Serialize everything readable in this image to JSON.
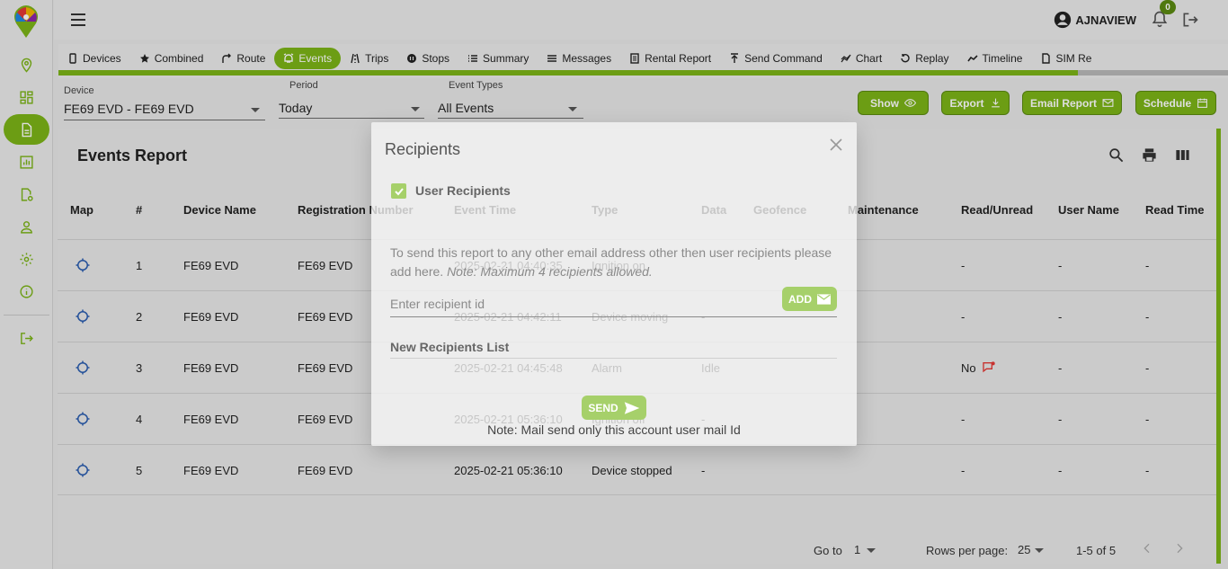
{
  "header": {
    "username": "AJNAVIEW",
    "notification_count": "0"
  },
  "sidebar": {
    "items": [
      {
        "icon": "map-pin-icon",
        "active": false
      },
      {
        "icon": "dashboard-icon",
        "active": false
      },
      {
        "icon": "report-icon",
        "active": true
      },
      {
        "icon": "chart-icon",
        "active": false
      },
      {
        "icon": "document-settings-icon",
        "active": false
      },
      {
        "icon": "user-icon",
        "active": false
      },
      {
        "icon": "gear-icon",
        "active": false
      },
      {
        "icon": "info-icon",
        "active": false
      },
      {
        "icon": "logout-icon",
        "active": false
      }
    ]
  },
  "tabs": [
    {
      "label": "Devices",
      "icon": "phone-icon"
    },
    {
      "label": "Combined",
      "icon": "star-icon"
    },
    {
      "label": "Route",
      "icon": "route-icon"
    },
    {
      "label": "Events",
      "icon": "alarm-icon",
      "active": true
    },
    {
      "label": "Trips",
      "icon": "trips-icon"
    },
    {
      "label": "Stops",
      "icon": "stop-icon"
    },
    {
      "label": "Summary",
      "icon": "list-icon"
    },
    {
      "label": "Messages",
      "icon": "messages-icon"
    },
    {
      "label": "Rental Report",
      "icon": "rental-icon"
    },
    {
      "label": "Send Command",
      "icon": "upload-icon"
    },
    {
      "label": "Chart",
      "icon": "chart-line-icon"
    },
    {
      "label": "Replay",
      "icon": "replay-icon"
    },
    {
      "label": "Timeline",
      "icon": "timeline-icon"
    },
    {
      "label": "SIM Re",
      "icon": "sim-icon"
    }
  ],
  "filters": {
    "device_label": "Device",
    "device_value": "FE69 EVD - FE69 EVD",
    "period_label": "Period",
    "period_value": "Today",
    "event_types_label": "Event Types",
    "event_types_value": "All Events"
  },
  "actions": {
    "show": "Show",
    "export": "Export",
    "email_report": "Email Report",
    "schedule": "Schedule"
  },
  "report": {
    "title": "Events Report",
    "columns": [
      "Map",
      "#",
      "Device Name",
      "Registration Number",
      "Event Time",
      "Type",
      "Data",
      "Geofence",
      "Maintenance",
      "Read/Unread",
      "User Name",
      "Read Time"
    ],
    "rows": [
      {
        "num": "1",
        "device": "FE69 EVD",
        "reg": "FE69 EVD",
        "time": "2025-02-21 04:40:35",
        "type": "Ignition on",
        "data": "",
        "read": "-",
        "user": "-",
        "read_time": "-"
      },
      {
        "num": "2",
        "device": "FE69 EVD",
        "reg": "FE69 EVD",
        "time": "2025-02-21 04:42:11",
        "type": "Device moving",
        "data": "-",
        "read": "-",
        "user": "-",
        "read_time": "-"
      },
      {
        "num": "3",
        "device": "FE69 EVD",
        "reg": "FE69 EVD",
        "time": "2025-02-21 04:45:48",
        "type": "Alarm",
        "data": "Idle",
        "read": "No",
        "user": "-",
        "read_time": "-"
      },
      {
        "num": "4",
        "device": "FE69 EVD",
        "reg": "FE69 EVD",
        "time": "2025-02-21 05:36:10",
        "type": "Ignition off",
        "data": "-",
        "read": "-",
        "user": "-",
        "read_time": "-"
      },
      {
        "num": "5",
        "device": "FE69 EVD",
        "reg": "FE69 EVD",
        "time": "2025-02-21 05:36:10",
        "type": "Device stopped",
        "data": "-",
        "read": "-",
        "user": "-",
        "read_time": "-"
      }
    ],
    "footer": {
      "goto_label": "Go to",
      "goto_value": "1",
      "rows_per_page_label": "Rows per page:",
      "rows_per_page_value": "25",
      "range": "1-5 of 5"
    }
  },
  "dialog": {
    "title": "Recipients",
    "user_recipients_label": "User Recipients",
    "user_recipients_checked": true,
    "info_text": "To send this report to any other email address other then user recipients please add here.",
    "info_note": "Note: Maximum 4 recipients allowed.",
    "recipient_placeholder": "Enter recipient id",
    "add_label": "ADD",
    "list_heading": "New Recipients List",
    "send_label": "SEND",
    "bottom_note": "Note: Mail send only this account user mail Id"
  },
  "colors": {
    "accent": "#7cb518",
    "accent_dark": "#5b8a12",
    "accent_light": "#a6d06a",
    "unread_icon": "#e53935"
  }
}
